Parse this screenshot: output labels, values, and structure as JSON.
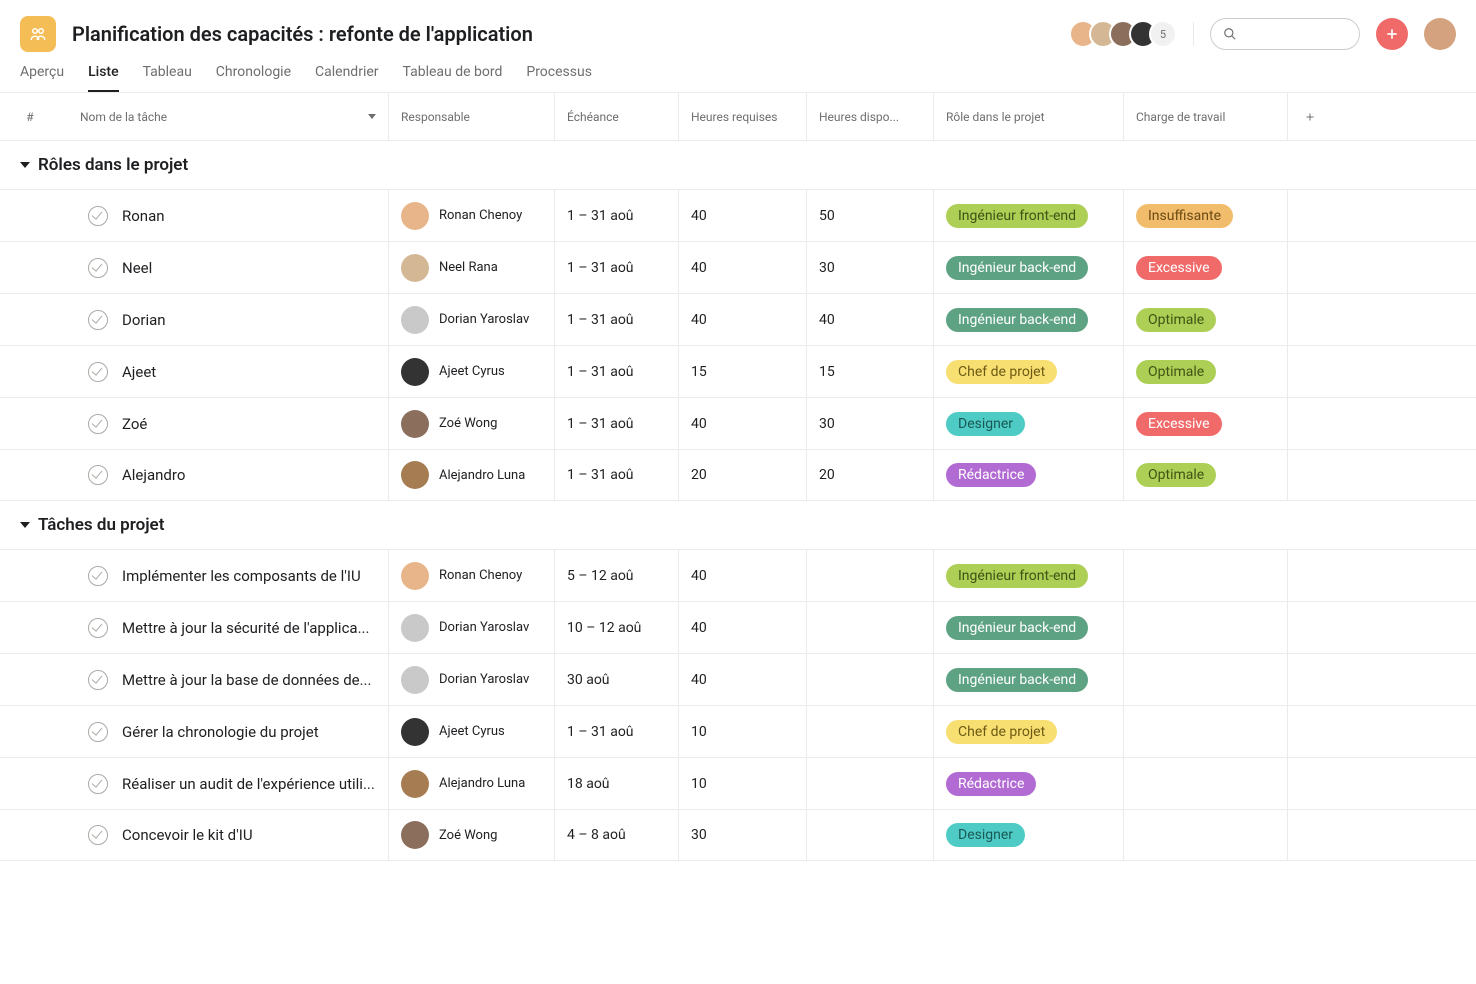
{
  "project": {
    "title": "Planification des capacités : refonte de l'application"
  },
  "avatars_extra": "5",
  "tabs": {
    "apercu": "Aperçu",
    "liste": "Liste",
    "tableau": "Tableau",
    "chronologie": "Chronologie",
    "calendrier": "Calendrier",
    "tableau_bord": "Tableau de bord",
    "processus": "Processus"
  },
  "headers": {
    "hash": "#",
    "name": "Nom de la tâche",
    "resp": "Responsable",
    "echeance": "Échéance",
    "hreq": "Heures requises",
    "hdisp": "Heures dispo...",
    "role": "Rôle dans le projet",
    "charge": "Charge de travail"
  },
  "sections": {
    "roles": {
      "title": "Rôles dans le projet"
    },
    "taches": {
      "title": "Tâches du projet"
    }
  },
  "roles_rows": [
    {
      "task": "Ronan",
      "resp": "Ronan Chenoy",
      "date": "1 – 31 aoû",
      "hreq": "40",
      "hdisp": "50",
      "role": "Ingénieur front-end",
      "role_cls": "pill-frontend",
      "charge": "Insuffisante",
      "charge_cls": "pill-insuff",
      "av": "av-c1"
    },
    {
      "task": "Neel",
      "resp": "Neel Rana",
      "date": "1 – 31 aoû",
      "hreq": "40",
      "hdisp": "30",
      "role": "Ingénieur back-end",
      "role_cls": "pill-backend",
      "charge": "Excessive",
      "charge_cls": "pill-excess",
      "av": "av-c2"
    },
    {
      "task": "Dorian",
      "resp": "Dorian Yaroslav",
      "date": "1 – 31 aoû",
      "hreq": "40",
      "hdisp": "40",
      "role": "Ingénieur back-end",
      "role_cls": "pill-backend",
      "charge": "Optimale",
      "charge_cls": "pill-opt",
      "av": "av-c3"
    },
    {
      "task": "Ajeet",
      "resp": "Ajeet Cyrus",
      "date": "1 – 31 aoû",
      "hreq": "15",
      "hdisp": "15",
      "role": "Chef de projet",
      "role_cls": "pill-chef",
      "charge": "Optimale",
      "charge_cls": "pill-opt",
      "av": "av-c4"
    },
    {
      "task": "Zoé",
      "resp": "Zoé Wong",
      "date": "1 – 31 aoû",
      "hreq": "40",
      "hdisp": "30",
      "role": "Designer",
      "role_cls": "pill-designer",
      "charge": "Excessive",
      "charge_cls": "pill-excess",
      "av": "av-c5"
    },
    {
      "task": "Alejandro",
      "resp": "Alejandro Luna",
      "date": "1 – 31 aoû",
      "hreq": "20",
      "hdisp": "20",
      "role": "Rédactrice",
      "role_cls": "pill-redac",
      "charge": "Optimale",
      "charge_cls": "pill-opt",
      "av": "av-c6"
    }
  ],
  "taches_rows": [
    {
      "task": "Implémenter les composants de l'IU",
      "resp": "Ronan Chenoy",
      "date": "5 – 12 aoû",
      "hreq": "40",
      "hdisp": "",
      "role": "Ingénieur front-end",
      "role_cls": "pill-frontend",
      "charge": "",
      "av": "av-c1"
    },
    {
      "task": "Mettre à jour la sécurité de l'applica...",
      "resp": "Dorian Yaroslav",
      "date": "10 – 12 aoû",
      "hreq": "40",
      "hdisp": "",
      "role": "Ingénieur back-end",
      "role_cls": "pill-backend",
      "charge": "",
      "av": "av-c3"
    },
    {
      "task": "Mettre à jour la base de données de...",
      "resp": "Dorian Yaroslav",
      "date": "30 aoû",
      "hreq": "40",
      "hdisp": "",
      "role": "Ingénieur back-end",
      "role_cls": "pill-backend",
      "charge": "",
      "av": "av-c3"
    },
    {
      "task": "Gérer la chronologie du projet",
      "resp": "Ajeet Cyrus",
      "date": "1 – 31 aoû",
      "hreq": "10",
      "hdisp": "",
      "role": "Chef de projet",
      "role_cls": "pill-chef",
      "charge": "",
      "av": "av-c4"
    },
    {
      "task": "Réaliser un audit de l'expérience utili...",
      "resp": "Alejandro Luna",
      "date": "18 aoû",
      "hreq": "10",
      "hdisp": "",
      "role": "Rédactrice",
      "role_cls": "pill-redac",
      "charge": "",
      "av": "av-c6"
    },
    {
      "task": "Concevoir le kit d'IU",
      "resp": "Zoé Wong",
      "date": "4 – 8 aoû",
      "hreq": "30",
      "hdisp": "",
      "role": "Designer",
      "role_cls": "pill-designer",
      "charge": "",
      "av": "av-c5"
    }
  ]
}
